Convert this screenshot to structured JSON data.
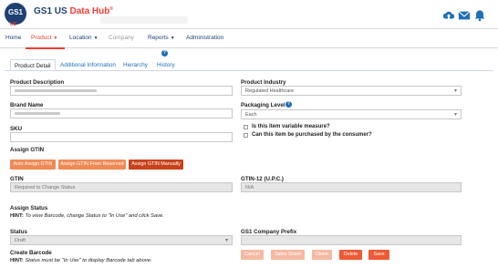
{
  "header": {
    "logo_text": "GS1",
    "logo_sub": "US",
    "brand_main": "GS1 US ",
    "brand_accent": "Data Hub",
    "brand_reg": "®",
    "icons": [
      "cloud-upload-icon",
      "envelope-icon",
      "bell-icon"
    ]
  },
  "nav": {
    "items": [
      {
        "label": "Home"
      },
      {
        "label": "Product",
        "active": true
      },
      {
        "label": "Location"
      },
      {
        "label": "Company",
        "disabled": true
      },
      {
        "label": "Reports"
      },
      {
        "label": "Administration"
      }
    ]
  },
  "tabs": [
    {
      "label": "Product Detail",
      "active": true
    },
    {
      "label": "Additional Information"
    },
    {
      "label": "Hierarchy"
    },
    {
      "label": "History"
    }
  ],
  "form": {
    "product_description_label": "Product Description",
    "brand_name_label": "Brand Name",
    "sku_label": "SKU",
    "assign_gtin_label": "Assign GTIN",
    "gtin_label": "GTIN",
    "gtin_value": "Required to Change Status",
    "gtin12_label": "GTIN-12 (U.P.C.)",
    "gtin12_value": "N/A",
    "product_industry_label": "Product Industry",
    "product_industry_value": "Regulated Healthcare",
    "packaging_level_label": "Packaging Level",
    "packaging_level_value": "Each",
    "variable_measure_label": "Is this item variable measure?",
    "purchased_by_consumer_label": "Can this item be purchased by the consumer?",
    "assign_status_label": "Assign Status",
    "assign_status_hint_prefix": "HINT:",
    "assign_status_hint": "To view Barcode, change Status to \"In Use\" and click Save.",
    "status_label": "Status",
    "status_value": "Draft",
    "company_prefix_label": "GS1 Company Prefix",
    "create_barcode_label": "Create Barcode",
    "create_barcode_hint_prefix": "HINT:",
    "create_barcode_hint": "Status must be \"In Use\" to display Barcode tab above."
  },
  "gtin_buttons": {
    "auto": "Auto Assign GTIN",
    "reserved": "Assign GTIN From Reserved",
    "manual": "Assign GTIN Manually"
  },
  "actions": {
    "cancel": "Cancel",
    "sales_sheet": "Sales Sheet",
    "clone": "Clone",
    "delete": "Delete",
    "save": "Save"
  },
  "colors": {
    "brand_navy": "#1f3f73",
    "accent_red": "#ef3e33",
    "link_blue": "#1f6fb5",
    "button_dark": "#c9421b",
    "button_orange": "#f08a55"
  }
}
